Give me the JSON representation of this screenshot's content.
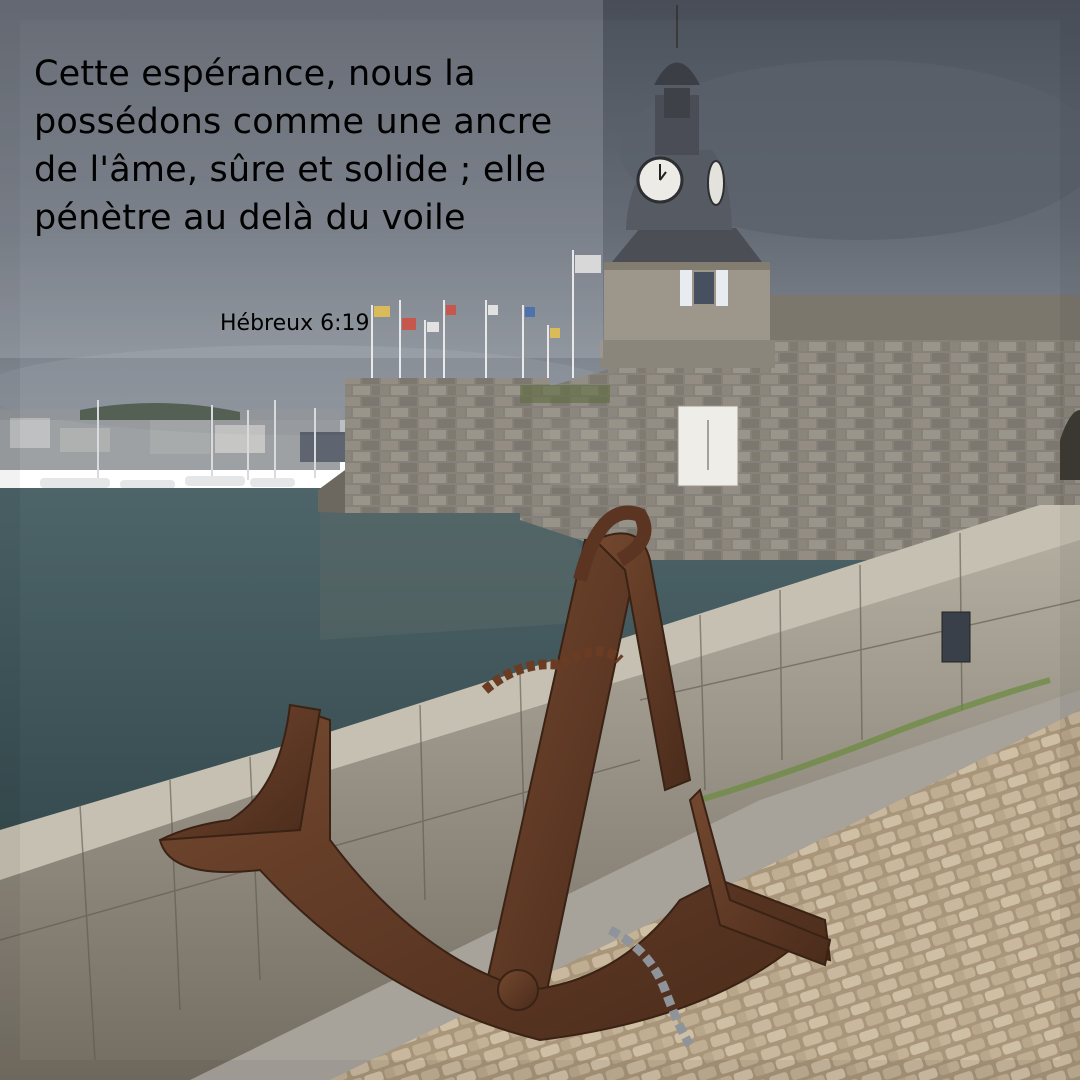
{
  "quote": {
    "text": "Cette espérance, nous la possédons comme une ancre de l'âme, sûre et solide ; elle pénètre au delà du voile",
    "reference": "Hébreux 6:19"
  },
  "colors": {
    "text": "#000000",
    "sky": "#565d68",
    "water": "#3f5a5e",
    "stone": "#8d8577",
    "anchor_rust": "#5e3a26",
    "cobblestone": "#bca98c"
  }
}
